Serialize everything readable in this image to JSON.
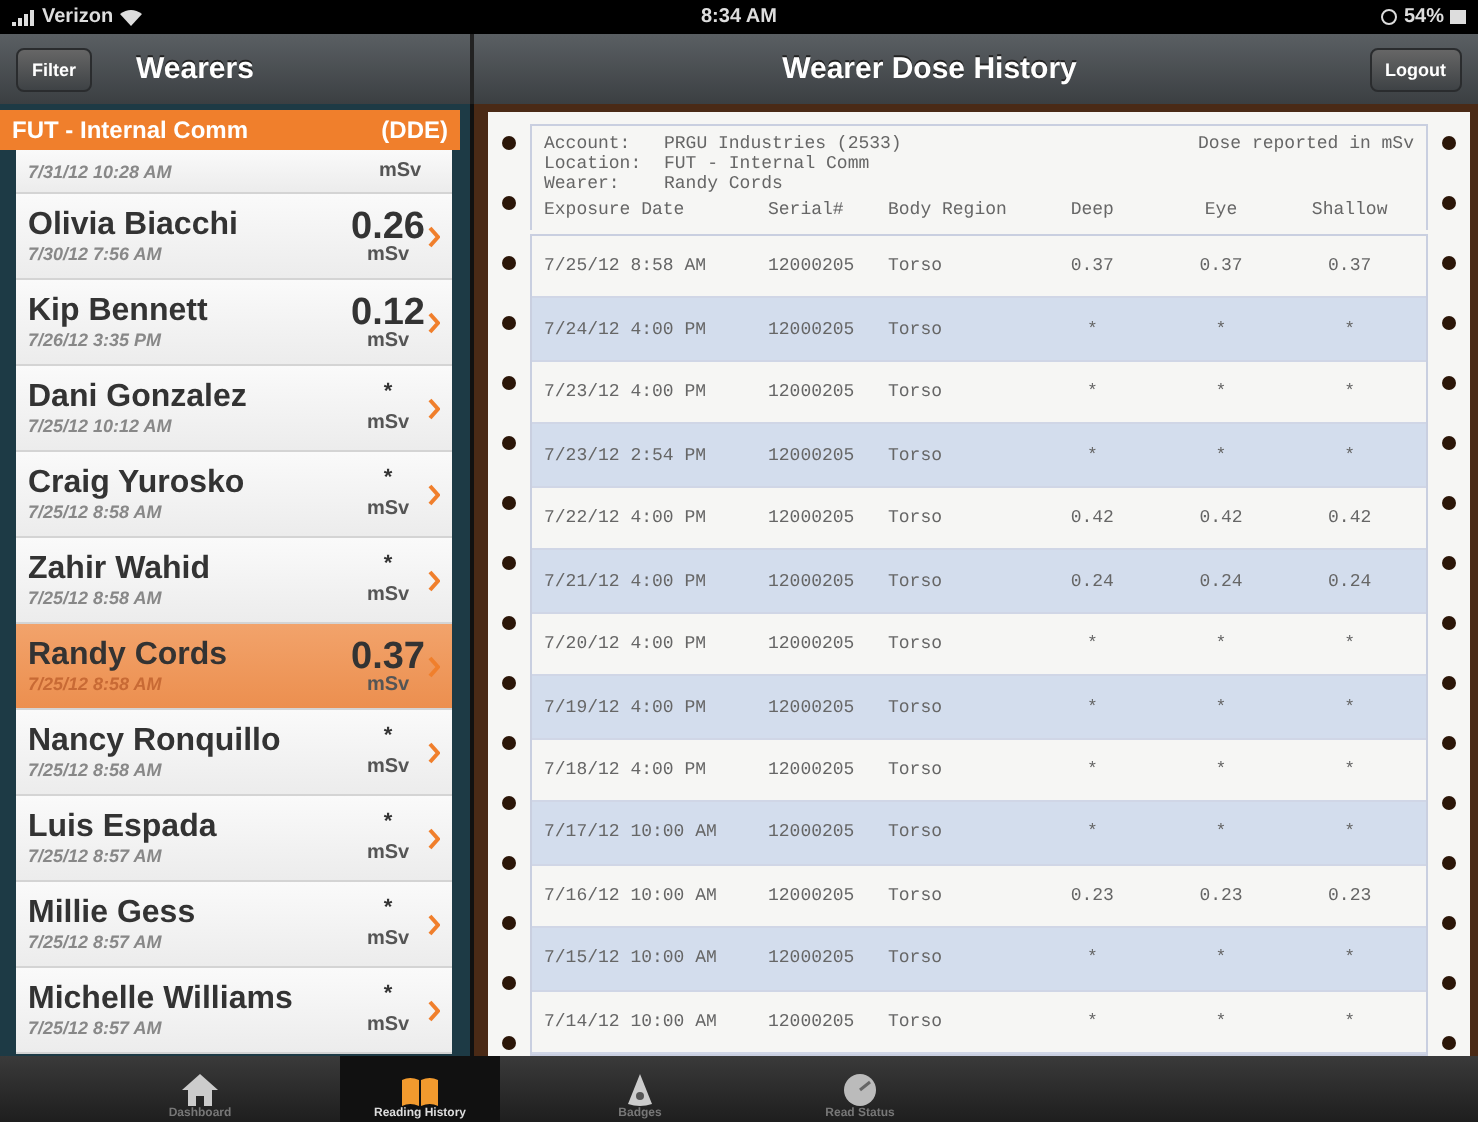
{
  "status_bar": {
    "carrier": "Verizon",
    "time": "8:34 AM",
    "battery": "54%"
  },
  "left_nav": {
    "filter_button": "Filter",
    "title": "Wearers"
  },
  "right_nav": {
    "title": "Wearer Dose History",
    "logout_button": "Logout"
  },
  "location_header": {
    "name": "FUT - Internal Comm",
    "code": "(DDE)"
  },
  "wearers": [
    {
      "kind": "partial",
      "date": "7/31/12 10:28 AM",
      "unit": "mSv",
      "selected": false
    },
    {
      "kind": "full",
      "name": "Olivia Biacchi",
      "date": "7/30/12 7:56 AM",
      "dose": "0.26",
      "unit": "mSv",
      "selected": false
    },
    {
      "kind": "full",
      "name": "Kip Bennett",
      "date": "7/26/12 3:35 PM",
      "dose": "0.12",
      "unit": "mSv",
      "selected": false
    },
    {
      "kind": "full",
      "name": "Dani Gonzalez",
      "date": "7/25/12 10:12 AM",
      "dose": "*",
      "unit": "mSv",
      "selected": false
    },
    {
      "kind": "full",
      "name": "Craig Yurosko",
      "date": "7/25/12 8:58 AM",
      "dose": "*",
      "unit": "mSv",
      "selected": false
    },
    {
      "kind": "full",
      "name": "Zahir Wahid",
      "date": "7/25/12 8:58 AM",
      "dose": "*",
      "unit": "mSv",
      "selected": false
    },
    {
      "kind": "full",
      "name": "Randy Cords",
      "date": "7/25/12 8:58 AM",
      "dose": "0.37",
      "unit": "mSv",
      "selected": true
    },
    {
      "kind": "full",
      "name": "Nancy Ronquillo",
      "date": "7/25/12 8:58 AM",
      "dose": "*",
      "unit": "mSv",
      "selected": false
    },
    {
      "kind": "full",
      "name": "Luis Espada",
      "date": "7/25/12 8:57 AM",
      "dose": "*",
      "unit": "mSv",
      "selected": false
    },
    {
      "kind": "full",
      "name": "Millie Gess",
      "date": "7/25/12 8:57 AM",
      "dose": "*",
      "unit": "mSv",
      "selected": false
    },
    {
      "kind": "full",
      "name": "Michelle Williams",
      "date": "7/25/12 8:57 AM",
      "dose": "*",
      "unit": "mSv",
      "selected": false
    }
  ],
  "report": {
    "account_label": "Account:",
    "account": "PRGU Industries (2533)",
    "note": "Dose reported in mSv",
    "location_label": "Location:",
    "location": "FUT - Internal Comm",
    "wearer_label": "Wearer:",
    "wearer": "Randy Cords",
    "columns": [
      "Exposure Date",
      "Serial#",
      "Body Region",
      "Deep",
      "Eye",
      "Shallow"
    ],
    "rows": [
      [
        "7/25/12 8:58 AM",
        "12000205",
        "Torso",
        "0.37",
        "0.37",
        "0.37"
      ],
      [
        "7/24/12 4:00 PM",
        "12000205",
        "Torso",
        "*",
        "*",
        "*"
      ],
      [
        "7/23/12 4:00 PM",
        "12000205",
        "Torso",
        "*",
        "*",
        "*"
      ],
      [
        "7/23/12 2:54 PM",
        "12000205",
        "Torso",
        "*",
        "*",
        "*"
      ],
      [
        "7/22/12 4:00 PM",
        "12000205",
        "Torso",
        "0.42",
        "0.42",
        "0.42"
      ],
      [
        "7/21/12 4:00 PM",
        "12000205",
        "Torso",
        "0.24",
        "0.24",
        "0.24"
      ],
      [
        "7/20/12 4:00 PM",
        "12000205",
        "Torso",
        "*",
        "*",
        "*"
      ],
      [
        "7/19/12 4:00 PM",
        "12000205",
        "Torso",
        "*",
        "*",
        "*"
      ],
      [
        "7/18/12 4:00 PM",
        "12000205",
        "Torso",
        "*",
        "*",
        "*"
      ],
      [
        "7/17/12 10:00 AM",
        "12000205",
        "Torso",
        "*",
        "*",
        "*"
      ],
      [
        "7/16/12 10:00 AM",
        "12000205",
        "Torso",
        "0.23",
        "0.23",
        "0.23"
      ],
      [
        "7/15/12 10:00 AM",
        "12000205",
        "Torso",
        "*",
        "*",
        "*"
      ],
      [
        "7/14/12 10:00 AM",
        "12000205",
        "Torso",
        "*",
        "*",
        "*"
      ]
    ]
  },
  "tabs": [
    {
      "kind": "home",
      "label": "Dashboard",
      "selected": false
    },
    {
      "kind": "book",
      "label": "Reading History",
      "selected": true
    },
    {
      "kind": "badge",
      "label": "Badges",
      "selected": false
    },
    {
      "kind": "gauge",
      "label": "Read Status",
      "selected": false
    }
  ]
}
